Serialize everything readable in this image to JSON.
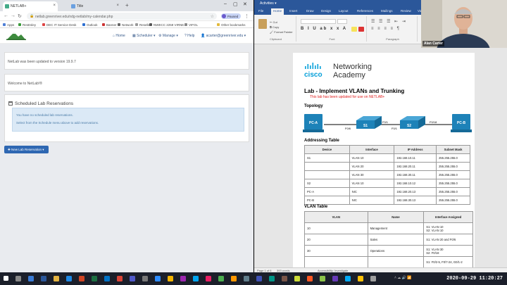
{
  "browser": {
    "tabs": [
      {
        "label": "NETLAB+"
      },
      {
        "label": "Title"
      }
    ],
    "url": "netlab.greenriver.edu/ndg-netlab/my-calendar.php",
    "profile_label": "Paused",
    "bookmarks": [
      "Apps",
      "ResEsley",
      "DEC IT Service Desk",
      "Outlook",
      "Banner",
      "Network",
      "Reseller",
      "NWECC 2259 VIRNE...",
      "VIFOL",
      "Other bookmarks"
    ],
    "nav": {
      "home": "Home",
      "scheduler": "Scheduler",
      "manage": "Manage",
      "help": "Help",
      "user": "acarter@greenriver.edu"
    },
    "messages": {
      "update": "NetLab was been updated to version 19.9.7",
      "welcome": "Welcome to NetLab!®"
    },
    "reservations": {
      "title": "Scheduled Lab Reservations",
      "notice_line1": "You have no scheduled lab reservations.",
      "notice_line2": "Select from the Schedule menu above to add reservations."
    },
    "new_button": "New Lab Reservation ▾"
  },
  "word": {
    "title": "Activities ▾",
    "tabs": [
      "File",
      "Home",
      "Insert",
      "Draw",
      "Design",
      "Layout",
      "References",
      "Mailings",
      "Review",
      "View"
    ],
    "ribbon_groups": [
      "Clipboard",
      "Font",
      "Paragraph",
      "Styles"
    ],
    "clipboard": {
      "cut": "Cut",
      "copy": "Copy",
      "format_painter": "Format Painter"
    },
    "doc": {
      "brand_line1": "Networking",
      "brand_line2": "Academy",
      "cisco_text": "cisco",
      "title": "Lab - Implement VLANs and Trunking",
      "subtitle": "This lab has been updated for use on NETLAB+",
      "topology_heading": "Topology",
      "topology": {
        "pca": "PC-A",
        "pcb": "PC-B",
        "s1": "S1",
        "s2": "S2",
        "port_pca_s1": "F0/6",
        "port_s1_trunk": "F0/1",
        "port_s2_trunk": "F0/1",
        "port_s2_pcb": "F0/18"
      },
      "addressing_heading": "Addressing Table",
      "addressing_headers": [
        "Device",
        "Interface",
        "IP Address",
        "Subnet Mask"
      ],
      "addressing_rows": [
        [
          "S1",
          "VLAN 10",
          "192.168.10.11",
          "255.255.255.0"
        ],
        [
          "",
          "VLAN 20",
          "192.168.20.11",
          "255.255.255.0"
        ],
        [
          "",
          "VLAN 30",
          "192.168.30.11",
          "255.255.255.0"
        ],
        [
          "S2",
          "VLAN 10",
          "192.168.10.12",
          "255.255.255.0"
        ],
        [
          "PC-A",
          "NIC",
          "192.168.20.13",
          "255.255.255.0"
        ],
        [
          "PC-B",
          "NIC",
          "192.168.30.13",
          "255.255.255.0"
        ]
      ],
      "vlan_heading": "VLAN Table",
      "vlan_headers": [
        "VLAN",
        "Name",
        "Interface Assigned"
      ],
      "vlan_rows": [
        [
          "10",
          "Management",
          "S1: VLAN 10\nS2: VLAN 10"
        ],
        [
          "20",
          "Sales",
          "S1: VLAN 20 and F0/6"
        ],
        [
          "30",
          "Operations",
          "S1: VLAN 30\nS2: F0/18"
        ],
        [
          "",
          "",
          "S1: F0/2-5, F0/7-24, G0/1-2"
        ]
      ]
    },
    "status_left": "Page 1 of 6",
    "status_mid": "393 words",
    "status_right": "Accessibility: Investigate"
  },
  "webcam": {
    "name": "Alan Carter"
  },
  "taskbar": {
    "clock": "2020-09-29  11:20:27"
  },
  "colors": {
    "word_blue": "#2b579a",
    "netlab_button": "#2e67b2",
    "notice_bg": "#dbe9f6",
    "cisco_blue": "#049fd9",
    "red_note": "#e02020"
  }
}
